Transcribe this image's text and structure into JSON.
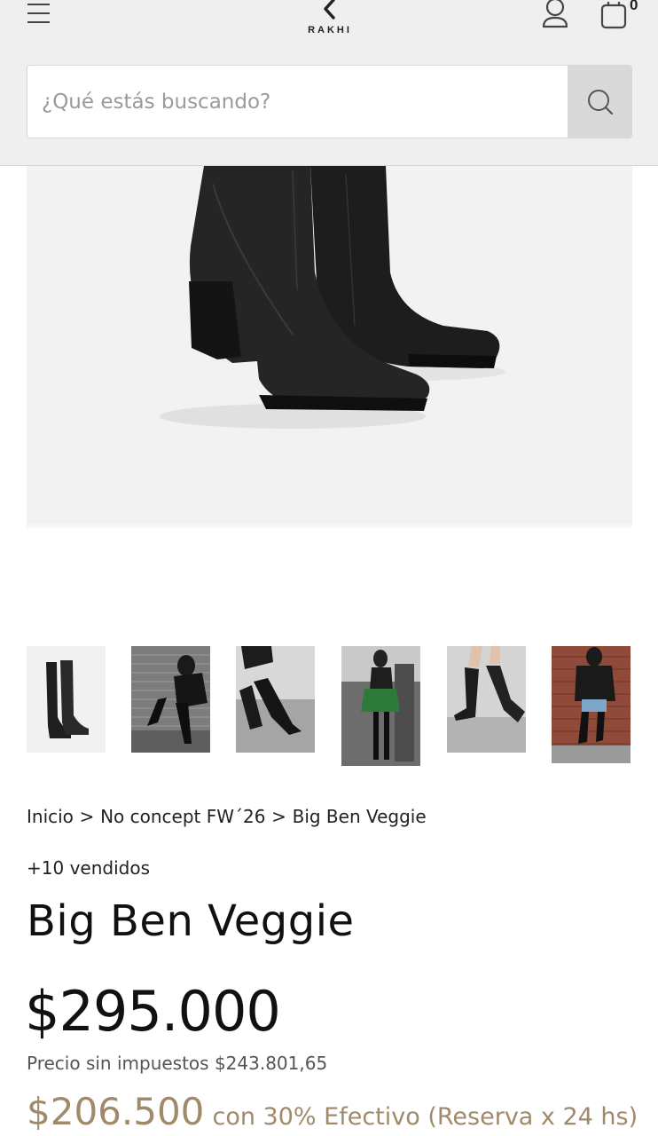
{
  "header": {
    "logo_text": "RAKHI",
    "cart_count": "0"
  },
  "search": {
    "placeholder": "¿Qué estás buscando?"
  },
  "breadcrumb": {
    "items": [
      "Inicio",
      "No concept FW´26",
      "Big Ben Veggie"
    ],
    "separator": ">"
  },
  "product": {
    "sold": "+10 vendidos",
    "title": "Big Ben Veggie",
    "price": "$295.000",
    "tax_label": "Precio sin impuestos",
    "tax_value": "$243.801,65",
    "cash_price": "$206.500",
    "cash_note": "con 30% Efectivo (Reserva x 24 hs)"
  },
  "colors": {
    "header_bg": "#efefef",
    "accent_cash": "#a08a6c",
    "text": "#111111"
  },
  "icons": [
    "hamburger-menu-icon",
    "rakhi-logo",
    "user-icon",
    "shopping-bag-icon",
    "search-icon"
  ]
}
